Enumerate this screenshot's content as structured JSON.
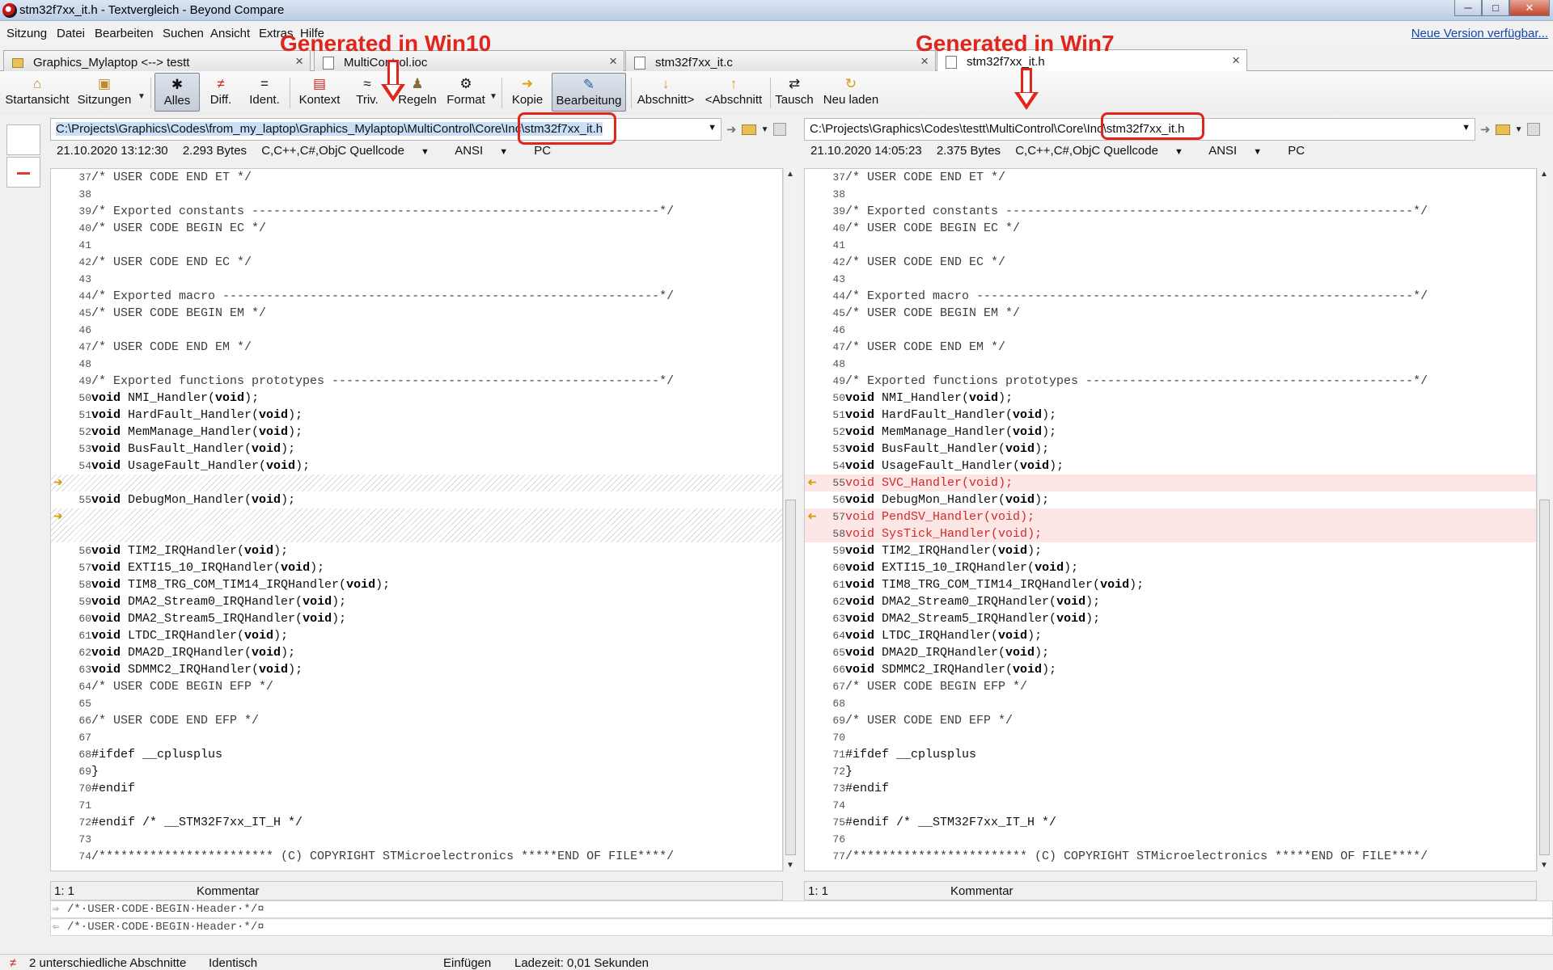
{
  "window": {
    "title": "stm32f7xx_it.h - Textvergleich - Beyond Compare"
  },
  "menu": [
    "Sitzung",
    "Datei",
    "Bearbeiten",
    "Suchen",
    "Ansicht",
    "Extras",
    "Hilfe"
  ],
  "new_version": "Neue Version verfügbar...",
  "annotations": {
    "left": "Generated in Win10",
    "right": "Generated in Win7"
  },
  "tabs": [
    {
      "label": "Graphics_Mylaptop <--> testt",
      "icon": "folder-compare-icon"
    },
    {
      "label": "MultiControl.ioc",
      "icon": "file-icon"
    },
    {
      "label": "stm32f7xx_it.c",
      "icon": "file-icon"
    },
    {
      "label": "stm32f7xx_it.h",
      "icon": "file-icon",
      "active": true
    }
  ],
  "toolbar": {
    "home": "Startansicht",
    "sessions": "Sitzungen",
    "all": "Alles",
    "diff": "Diff.",
    "same": "Ident.",
    "context": "Kontext",
    "minor": "Triv.",
    "rules": "Regeln",
    "format": "Format",
    "copy": "Kopie",
    "edit": "Bearbeitung",
    "next_section": "Abschnitt>",
    "prev_section": "<Abschnitt",
    "swap": "Tausch",
    "reload": "Neu laden"
  },
  "left": {
    "path": "C:\\Projects\\Graphics\\Codes\\from_my_laptop\\Graphics_Mylaptop\\MultiControl\\Core\\Inc\\stm32f7xx_it.h",
    "date": "21.10.2020 13:12:30",
    "size": "2.293 Bytes",
    "format": "C,C++,C#,ObjC Quellcode",
    "encoding": "ANSI",
    "eol": "PC",
    "cursor": "1: 1",
    "mode": "Kommentar"
  },
  "right": {
    "path": "C:\\Projects\\Graphics\\Codes\\testt\\MultiControl\\Core\\Inc\\stm32f7xx_it.h",
    "date": "21.10.2020 14:05:23",
    "size": "2.375 Bytes",
    "format": "C,C++,C#,ObjC Quellcode",
    "encoding": "ANSI",
    "eol": "PC",
    "cursor": "1: 1",
    "mode": "Kommentar"
  },
  "code_left": [
    {
      "n": "37",
      "t": "/* USER CODE END ET */"
    },
    {
      "n": "38",
      "t": ""
    },
    {
      "n": "39",
      "t": "/* Exported constants --------------------------------------------------------*/"
    },
    {
      "n": "40",
      "t": "/* USER CODE BEGIN EC */"
    },
    {
      "n": "41",
      "t": ""
    },
    {
      "n": "42",
      "t": "/* USER CODE END EC */"
    },
    {
      "n": "43",
      "t": ""
    },
    {
      "n": "44",
      "t": "/* Exported macro ------------------------------------------------------------*/"
    },
    {
      "n": "45",
      "t": "/* USER CODE BEGIN EM */"
    },
    {
      "n": "46",
      "t": ""
    },
    {
      "n": "47",
      "t": "/* USER CODE END EM */"
    },
    {
      "n": "48",
      "t": ""
    },
    {
      "n": "49",
      "t": "/* Exported functions prototypes ---------------------------------------------*/"
    },
    {
      "n": "50",
      "k": "void",
      "t": " NMI_Handler(",
      "k2": "void",
      "e": ");"
    },
    {
      "n": "51",
      "k": "void",
      "t": " HardFault_Handler(",
      "k2": "void",
      "e": ");"
    },
    {
      "n": "52",
      "k": "void",
      "t": " MemManage_Handler(",
      "k2": "void",
      "e": ");"
    },
    {
      "n": "53",
      "k": "void",
      "t": " BusFault_Handler(",
      "k2": "void",
      "e": ");"
    },
    {
      "n": "54",
      "k": "void",
      "t": " UsageFault_Handler(",
      "k2": "void",
      "e": ");"
    },
    {
      "n": "",
      "t": "",
      "hatch": true
    },
    {
      "n": "55",
      "k": "void",
      "t": " DebugMon_Handler(",
      "k2": "void",
      "e": ");"
    },
    {
      "n": "",
      "t": "",
      "hatch": true
    },
    {
      "n": "",
      "t": "",
      "hatch": true
    },
    {
      "n": "56",
      "k": "void",
      "t": " TIM2_IRQHandler(",
      "k2": "void",
      "e": ");"
    },
    {
      "n": "57",
      "k": "void",
      "t": " EXTI15_10_IRQHandler(",
      "k2": "void",
      "e": ");"
    },
    {
      "n": "58",
      "k": "void",
      "t": " TIM8_TRG_COM_TIM14_IRQHandler(",
      "k2": "void",
      "e": ");"
    },
    {
      "n": "59",
      "k": "void",
      "t": " DMA2_Stream0_IRQHandler(",
      "k2": "void",
      "e": ");"
    },
    {
      "n": "60",
      "k": "void",
      "t": " DMA2_Stream5_IRQHandler(",
      "k2": "void",
      "e": ");"
    },
    {
      "n": "61",
      "k": "void",
      "t": " LTDC_IRQHandler(",
      "k2": "void",
      "e": ");"
    },
    {
      "n": "62",
      "k": "void",
      "t": " DMA2D_IRQHandler(",
      "k2": "void",
      "e": ");"
    },
    {
      "n": "63",
      "k": "void",
      "t": " SDMMC2_IRQHandler(",
      "k2": "void",
      "e": ");"
    },
    {
      "n": "64",
      "t": "/* USER CODE BEGIN EFP */"
    },
    {
      "n": "65",
      "t": ""
    },
    {
      "n": "66",
      "t": "/* USER CODE END EFP */"
    },
    {
      "n": "67",
      "t": ""
    },
    {
      "n": "68",
      "t": "#ifdef __cplusplus"
    },
    {
      "n": "69",
      "t": "}"
    },
    {
      "n": "70",
      "t": "#endif"
    },
    {
      "n": "71",
      "t": ""
    },
    {
      "n": "72",
      "t": "#endif /* __STM32F7xx_IT_H */"
    },
    {
      "n": "73",
      "t": ""
    },
    {
      "n": "74",
      "t": "/************************ (C) COPYRIGHT STMicroelectronics *****END OF FILE****/"
    }
  ],
  "code_right": [
    {
      "n": "37",
      "t": "/* USER CODE END ET */"
    },
    {
      "n": "38",
      "t": ""
    },
    {
      "n": "39",
      "t": "/* Exported constants --------------------------------------------------------*/"
    },
    {
      "n": "40",
      "t": "/* USER CODE BEGIN EC */"
    },
    {
      "n": "41",
      "t": ""
    },
    {
      "n": "42",
      "t": "/* USER CODE END EC */"
    },
    {
      "n": "43",
      "t": ""
    },
    {
      "n": "44",
      "t": "/* Exported macro ------------------------------------------------------------*/"
    },
    {
      "n": "45",
      "t": "/* USER CODE BEGIN EM */"
    },
    {
      "n": "46",
      "t": ""
    },
    {
      "n": "47",
      "t": "/* USER CODE END EM */"
    },
    {
      "n": "48",
      "t": ""
    },
    {
      "n": "49",
      "t": "/* Exported functions prototypes ---------------------------------------------*/"
    },
    {
      "n": "50",
      "k": "void",
      "t": " NMI_Handler(",
      "k2": "void",
      "e": ");"
    },
    {
      "n": "51",
      "k": "void",
      "t": " HardFault_Handler(",
      "k2": "void",
      "e": ");"
    },
    {
      "n": "52",
      "k": "void",
      "t": " MemManage_Handler(",
      "k2": "void",
      "e": ");"
    },
    {
      "n": "53",
      "k": "void",
      "t": " BusFault_Handler(",
      "k2": "void",
      "e": ");"
    },
    {
      "n": "54",
      "k": "void",
      "t": " UsageFault_Handler(",
      "k2": "void",
      "e": ");"
    },
    {
      "n": "55",
      "k": "void",
      "t": " SVC_Handler(",
      "k2": "void",
      "e": ");",
      "diff": true
    },
    {
      "n": "56",
      "k": "void",
      "t": " DebugMon_Handler(",
      "k2": "void",
      "e": ");"
    },
    {
      "n": "57",
      "k": "void",
      "t": " PendSV_Handler(",
      "k2": "void",
      "e": ");",
      "diff": true
    },
    {
      "n": "58",
      "k": "void",
      "t": " SysTick_Handler(",
      "k2": "void",
      "e": ");",
      "diff": true
    },
    {
      "n": "59",
      "k": "void",
      "t": " TIM2_IRQHandler(",
      "k2": "void",
      "e": ");"
    },
    {
      "n": "60",
      "k": "void",
      "t": " EXTI15_10_IRQHandler(",
      "k2": "void",
      "e": ");"
    },
    {
      "n": "61",
      "k": "void",
      "t": " TIM8_TRG_COM_TIM14_IRQHandler(",
      "k2": "void",
      "e": ");"
    },
    {
      "n": "62",
      "k": "void",
      "t": " DMA2_Stream0_IRQHandler(",
      "k2": "void",
      "e": ");"
    },
    {
      "n": "63",
      "k": "void",
      "t": " DMA2_Stream5_IRQHandler(",
      "k2": "void",
      "e": ");"
    },
    {
      "n": "64",
      "k": "void",
      "t": " LTDC_IRQHandler(",
      "k2": "void",
      "e": ");"
    },
    {
      "n": "65",
      "k": "void",
      "t": " DMA2D_IRQHandler(",
      "k2": "void",
      "e": ");"
    },
    {
      "n": "66",
      "k": "void",
      "t": " SDMMC2_IRQHandler(",
      "k2": "void",
      "e": ");"
    },
    {
      "n": "67",
      "t": "/* USER CODE BEGIN EFP */"
    },
    {
      "n": "68",
      "t": ""
    },
    {
      "n": "69",
      "t": "/* USER CODE END EFP */"
    },
    {
      "n": "70",
      "t": ""
    },
    {
      "n": "71",
      "t": "#ifdef __cplusplus"
    },
    {
      "n": "72",
      "t": "}"
    },
    {
      "n": "73",
      "t": "#endif"
    },
    {
      "n": "74",
      "t": ""
    },
    {
      "n": "75",
      "t": "#endif /* __STM32F7xx_IT_H */"
    },
    {
      "n": "76",
      "t": ""
    },
    {
      "n": "77",
      "t": "/************************ (C) COPYRIGHT STMicroelectronics *****END OF FILE****/"
    }
  ],
  "preview": {
    "line1": "/*·USER·CODE·BEGIN·Header·*/¤",
    "line2": "/*·USER·CODE·BEGIN·Header·*/¤"
  },
  "statusbar": {
    "diffs": "2 unterschiedliche Abschnitte",
    "same": "Identisch",
    "insert": "Einfügen",
    "load": "Ladezeit: 0,01 Sekunden"
  }
}
